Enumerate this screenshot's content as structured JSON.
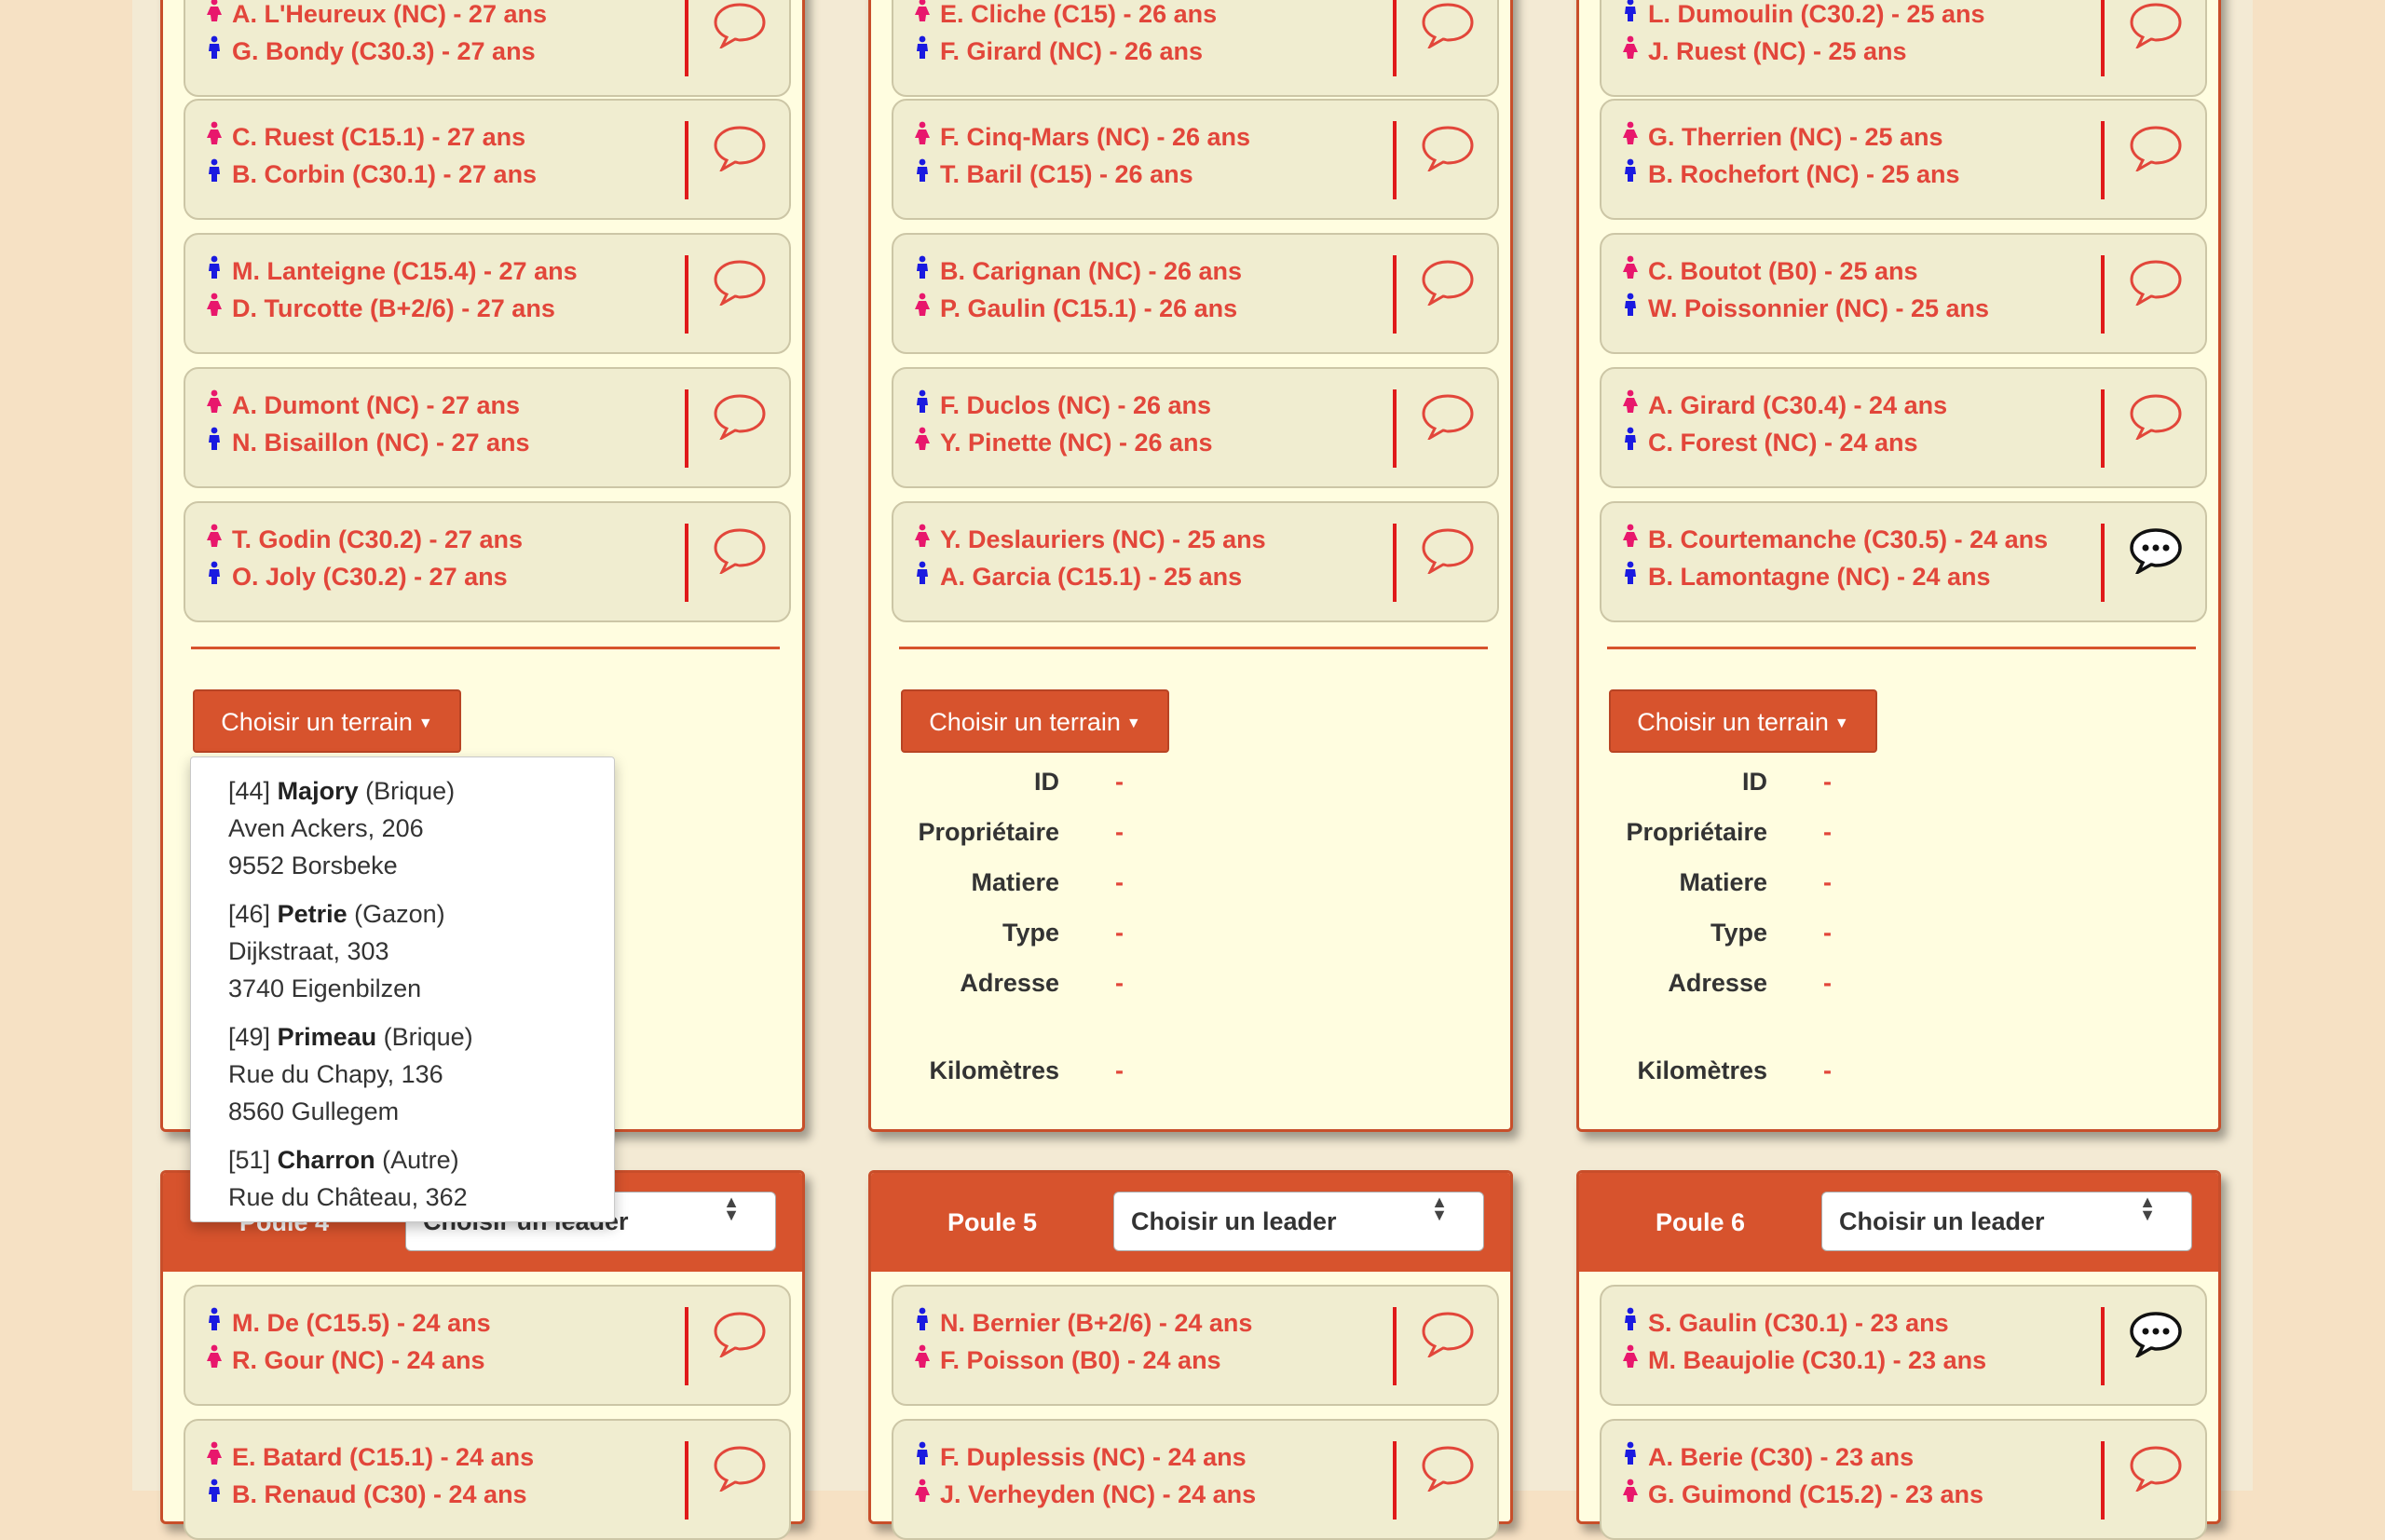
{
  "columns": [
    {
      "top_matches": [
        {
          "p1": {
            "g": "f",
            "t": "A. L'Heureux (NC) - 27 ans"
          },
          "p2": {
            "g": "m",
            "t": "G. Bondy (C30.3) - 27 ans"
          },
          "bubble": "empty"
        },
        {
          "p1": {
            "g": "f",
            "t": "C. Ruest (C15.1) - 27 ans"
          },
          "p2": {
            "g": "m",
            "t": "B. Corbin (C30.1) - 27 ans"
          },
          "bubble": "empty"
        },
        {
          "p1": {
            "g": "m",
            "t": "M. Lanteigne (C15.4) - 27 ans"
          },
          "p2": {
            "g": "f",
            "t": "D. Turcotte (B+2/6) - 27 ans"
          },
          "bubble": "empty"
        },
        {
          "p1": {
            "g": "f",
            "t": "A. Dumont (NC) - 27 ans"
          },
          "p2": {
            "g": "m",
            "t": "N. Bisaillon (NC) - 27 ans"
          },
          "bubble": "empty"
        },
        {
          "p1": {
            "g": "f",
            "t": "T. Godin (C30.2) - 27 ans"
          },
          "p2": {
            "g": "m",
            "t": "O. Joly (C30.2) - 27 ans"
          },
          "bubble": "empty"
        }
      ],
      "button": "Choisir un terrain",
      "poule": "Poule 4",
      "leader": "Choisir un leader",
      "bottom_matches": [
        {
          "p1": {
            "g": "m",
            "t": "M. De (C15.5) - 24 ans"
          },
          "p2": {
            "g": "f",
            "t": "R. Gour (NC) - 24 ans"
          },
          "bubble": "empty"
        },
        {
          "p1": {
            "g": "f",
            "t": "E. Batard (C15.1) - 24 ans"
          },
          "p2": {
            "g": "m",
            "t": "B. Renaud (C30) - 24 ans"
          },
          "bubble": "empty"
        }
      ]
    },
    {
      "top_matches": [
        {
          "p1": {
            "g": "f",
            "t": "E. Cliche (C15) - 26 ans"
          },
          "p2": {
            "g": "m",
            "t": "F. Girard (NC) - 26 ans"
          },
          "bubble": "empty"
        },
        {
          "p1": {
            "g": "f",
            "t": "F. Cinq-Mars (NC) - 26 ans"
          },
          "p2": {
            "g": "m",
            "t": "T. Baril (C15) - 26 ans"
          },
          "bubble": "empty"
        },
        {
          "p1": {
            "g": "m",
            "t": "B. Carignan (NC) - 26 ans"
          },
          "p2": {
            "g": "f",
            "t": "P. Gaulin (C15.1) - 26 ans"
          },
          "bubble": "empty"
        },
        {
          "p1": {
            "g": "m",
            "t": "F. Duclos (NC) - 26 ans"
          },
          "p2": {
            "g": "f",
            "t": "Y. Pinette (NC) - 26 ans"
          },
          "bubble": "empty"
        },
        {
          "p1": {
            "g": "f",
            "t": "Y. Deslauriers (NC) - 25 ans"
          },
          "p2": {
            "g": "m",
            "t": "A. Garcia (C15.1) - 25 ans"
          },
          "bubble": "empty"
        }
      ],
      "button": "Choisir un terrain",
      "poule": "Poule 5",
      "leader": "Choisir un leader",
      "bottom_matches": [
        {
          "p1": {
            "g": "m",
            "t": "N. Bernier (B+2/6) - 24 ans"
          },
          "p2": {
            "g": "f",
            "t": "F. Poisson (B0) - 24 ans"
          },
          "bubble": "empty"
        },
        {
          "p1": {
            "g": "m",
            "t": "F. Duplessis (NC) - 24 ans"
          },
          "p2": {
            "g": "f",
            "t": "J. Verheyden (NC) - 24 ans"
          },
          "bubble": "empty"
        }
      ]
    },
    {
      "top_matches": [
        {
          "p1": {
            "g": "m",
            "t": "L. Dumoulin (C30.2) - 25 ans"
          },
          "p2": {
            "g": "f",
            "t": "J. Ruest (NC) - 25 ans"
          },
          "bubble": "empty"
        },
        {
          "p1": {
            "g": "f",
            "t": "G. Therrien (NC) - 25 ans"
          },
          "p2": {
            "g": "m",
            "t": "B. Rochefort (NC) - 25 ans"
          },
          "bubble": "empty"
        },
        {
          "p1": {
            "g": "f",
            "t": "C. Boutot (B0) - 25 ans"
          },
          "p2": {
            "g": "m",
            "t": "W. Poissonnier (NC) - 25 ans"
          },
          "bubble": "empty"
        },
        {
          "p1": {
            "g": "f",
            "t": "A. Girard (C30.4) - 24 ans"
          },
          "p2": {
            "g": "m",
            "t": "C. Forest (NC) - 24 ans"
          },
          "bubble": "empty"
        },
        {
          "p1": {
            "g": "f",
            "t": "B. Courtemanche (C30.5) - 24 ans"
          },
          "p2": {
            "g": "m",
            "t": "B. Lamontagne (NC) - 24 ans"
          },
          "bubble": "filled"
        }
      ],
      "button": "Choisir un terrain",
      "poule": "Poule 6",
      "leader": "Choisir un leader",
      "bottom_matches": [
        {
          "p1": {
            "g": "m",
            "t": "S. Gaulin (C30.1) - 23 ans"
          },
          "p2": {
            "g": "f",
            "t": "M. Beaujolie (C30.1) - 23 ans"
          },
          "bubble": "filled"
        },
        {
          "p1": {
            "g": "m",
            "t": "A. Berie (C30) - 23 ans"
          },
          "p2": {
            "g": "f",
            "t": "G. Guimond (C15.2) - 23 ans"
          },
          "bubble": "empty"
        }
      ]
    }
  ],
  "info_labels": {
    "id": "ID",
    "owner": "Propriétaire",
    "matter": "Matiere",
    "type": "Type",
    "address": "Adresse",
    "km": "Kilomètres"
  },
  "info_value": "-",
  "dropdown": [
    {
      "num": "[44]",
      "name": "Majory",
      "kind": "(Brique)",
      "street": "Aven Ackers, 206",
      "city": "9552 Borsbeke"
    },
    {
      "num": "[46]",
      "name": "Petrie",
      "kind": "(Gazon)",
      "street": "Dijkstraat, 303",
      "city": "3740 Eigenbilzen"
    },
    {
      "num": "[49]",
      "name": "Primeau",
      "kind": "(Brique)",
      "street": "Rue du Chapy, 136",
      "city": "8560 Gullegem"
    },
    {
      "num": "[51]",
      "name": "Charron",
      "kind": "(Autre)",
      "street": "Rue du Château, 362",
      "city": ""
    }
  ],
  "colors": {
    "accent": "#d7532d",
    "female": "#e8176c",
    "male": "#1a1ae0",
    "text_red": "#e2463a"
  }
}
